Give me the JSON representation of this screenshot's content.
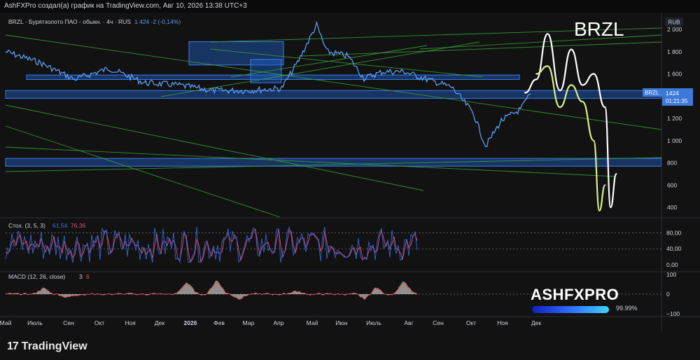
{
  "header": {
    "published": "AshFXPro создал(а) график на TradingView.com, Авг 10, 2026 13:38 UTC+3"
  },
  "legend": {
    "symbol_line": "BRZL · Бурятзолото ПАО - обыкн. · 4ч · RUS",
    "price_info": "1 424  -2 (-0,14%)",
    "ticker_big": "BRZL"
  },
  "price_axis": {
    "currency": "RUB",
    "ticks": [
      "2 000",
      "1 800",
      "1 600",
      "1 400",
      "1 200",
      "1 000",
      "800",
      "600",
      "400"
    ],
    "last_symbol": "BRZL",
    "last_price": "1424",
    "countdown": "01:21:35"
  },
  "stoch": {
    "label": "Стох. (3, 5, 3)",
    "k_value": "61,54",
    "d_value": "76,36",
    "ticks": [
      "80,00",
      "40,00",
      "0,00"
    ],
    "color_k": "#3b6fe0",
    "color_d": "#d9538a"
  },
  "macd": {
    "label": "MACD (12, 26, close)",
    "hist_value": "3",
    "signal_value": "6",
    "ticks": [
      "100",
      "0",
      "−100"
    ]
  },
  "time_axis": {
    "labels": [
      "Май",
      "Июль",
      "Сен",
      "Окт",
      "Ноя",
      "Дек",
      "2026",
      "Фев",
      "Мар",
      "Апр",
      "Май",
      "Июн",
      "Июль",
      "Авг",
      "Сен",
      "Окт",
      "Ноя",
      "Дек"
    ]
  },
  "brand": {
    "name": "ASHFXPRO",
    "progress_label": "99.99%",
    "progress_fraction": 0.9999
  },
  "footer": {
    "logo_mark": "17",
    "logo_text": "TradingView"
  },
  "colors": {
    "price_line": "#5b9bf0",
    "zone_fill": "#1f5fc8",
    "trendline": "#38a838",
    "projection_white": "#ffffff",
    "projection_yellow": "#d8ef8a",
    "background": "#121212"
  },
  "chart_data": {
    "type": "line",
    "symbol": "BRZL",
    "currency": "RUB",
    "timeframe": "4ч",
    "ylim": [
      300,
      2080
    ],
    "x_range": [
      "2025-05",
      "2026-12"
    ],
    "series": [
      {
        "x": [
          "2025-05",
          "2025-06",
          "2025-07",
          "2025-08",
          "2025-09",
          "2025-10",
          "2025-11",
          "2025-12",
          "2026-01",
          "2026-01-15",
          "2026-02",
          "2026-02-10",
          "2026-03",
          "2026-03-15",
          "2026-04",
          "2026-04-20",
          "2026-05",
          "2026-06",
          "2026-06-20",
          "2026-07",
          "2026-07-15",
          "2026-08",
          "2026-08-10"
        ],
        "y": [
          1800,
          1700,
          1550,
          1650,
          1520,
          1500,
          1450,
          1450,
          1470,
          1700,
          2040,
          1800,
          1760,
          1560,
          1620,
          1620,
          1580,
          1480,
          1250,
          950,
          1180,
          1280,
          1424
        ]
      }
    ],
    "zones": [
      {
        "y_low": 1380,
        "y_high": 1450
      },
      {
        "y_low": 1550,
        "y_high": 1590
      },
      {
        "y_low": 770,
        "y_high": 840
      },
      {
        "y_low": 1680,
        "y_high": 1890
      },
      {
        "y_low": 1520,
        "y_high": 1730
      }
    ],
    "projections": [
      {
        "color": "white",
        "x": [
          "2026-08-05",
          "2026-08-15",
          "2026-08-25",
          "2026-09-05",
          "2026-09-15",
          "2026-09-25",
          "2026-10-05",
          "2026-10-15",
          "2026-10-20",
          "2026-10-25"
        ],
        "y": [
          1430,
          1550,
          1960,
          1450,
          1820,
          1500,
          1600,
          1300,
          400,
          700
        ]
      },
      {
        "color": "yellow",
        "x": [
          "2026-08-15",
          "2026-08-25",
          "2026-09-05",
          "2026-09-15",
          "2026-09-25",
          "2026-10-05",
          "2026-10-10",
          "2026-10-15"
        ],
        "y": [
          1600,
          1670,
          1300,
          1500,
          1350,
          1000,
          370,
          600
        ]
      }
    ],
    "stoch_ylim": [
      0,
      100
    ],
    "stoch_last": {
      "k": 61.54,
      "d": 76.36
    },
    "macd_ylim": [
      -100,
      100
    ],
    "macd_last": {
      "hist": 3,
      "signal": 6
    },
    "grid": false
  }
}
